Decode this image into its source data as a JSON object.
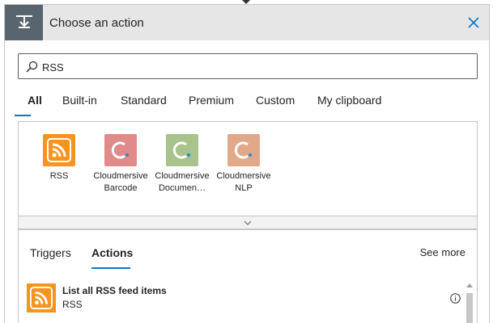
{
  "header": {
    "title": "Choose an action"
  },
  "search": {
    "value": "RSS"
  },
  "tabs": [
    "All",
    "Built-in",
    "Standard",
    "Premium",
    "Custom",
    "My clipboard"
  ],
  "connectors": [
    {
      "label": "RSS",
      "icon": "rss-icon",
      "color": "#f7941d"
    },
    {
      "label": "Cloudmersive Barcode",
      "icon": "cloudmersive-icon",
      "color": "#e08a8a"
    },
    {
      "label": "Cloudmersive Documen…",
      "icon": "cloudmersive-icon",
      "color": "#a9c38c"
    },
    {
      "label": "Cloudmersive NLP",
      "icon": "cloudmersive-icon",
      "color": "#e1a98a"
    }
  ],
  "subtabs": [
    "Triggers",
    "Actions"
  ],
  "see_more": "See more",
  "actions": [
    {
      "title": "List all RSS feed items",
      "subtitle": "RSS"
    }
  ],
  "colors": {
    "accent": "#0078d4",
    "rss": "#f7941d",
    "header_icon_bg": "#58646e"
  }
}
